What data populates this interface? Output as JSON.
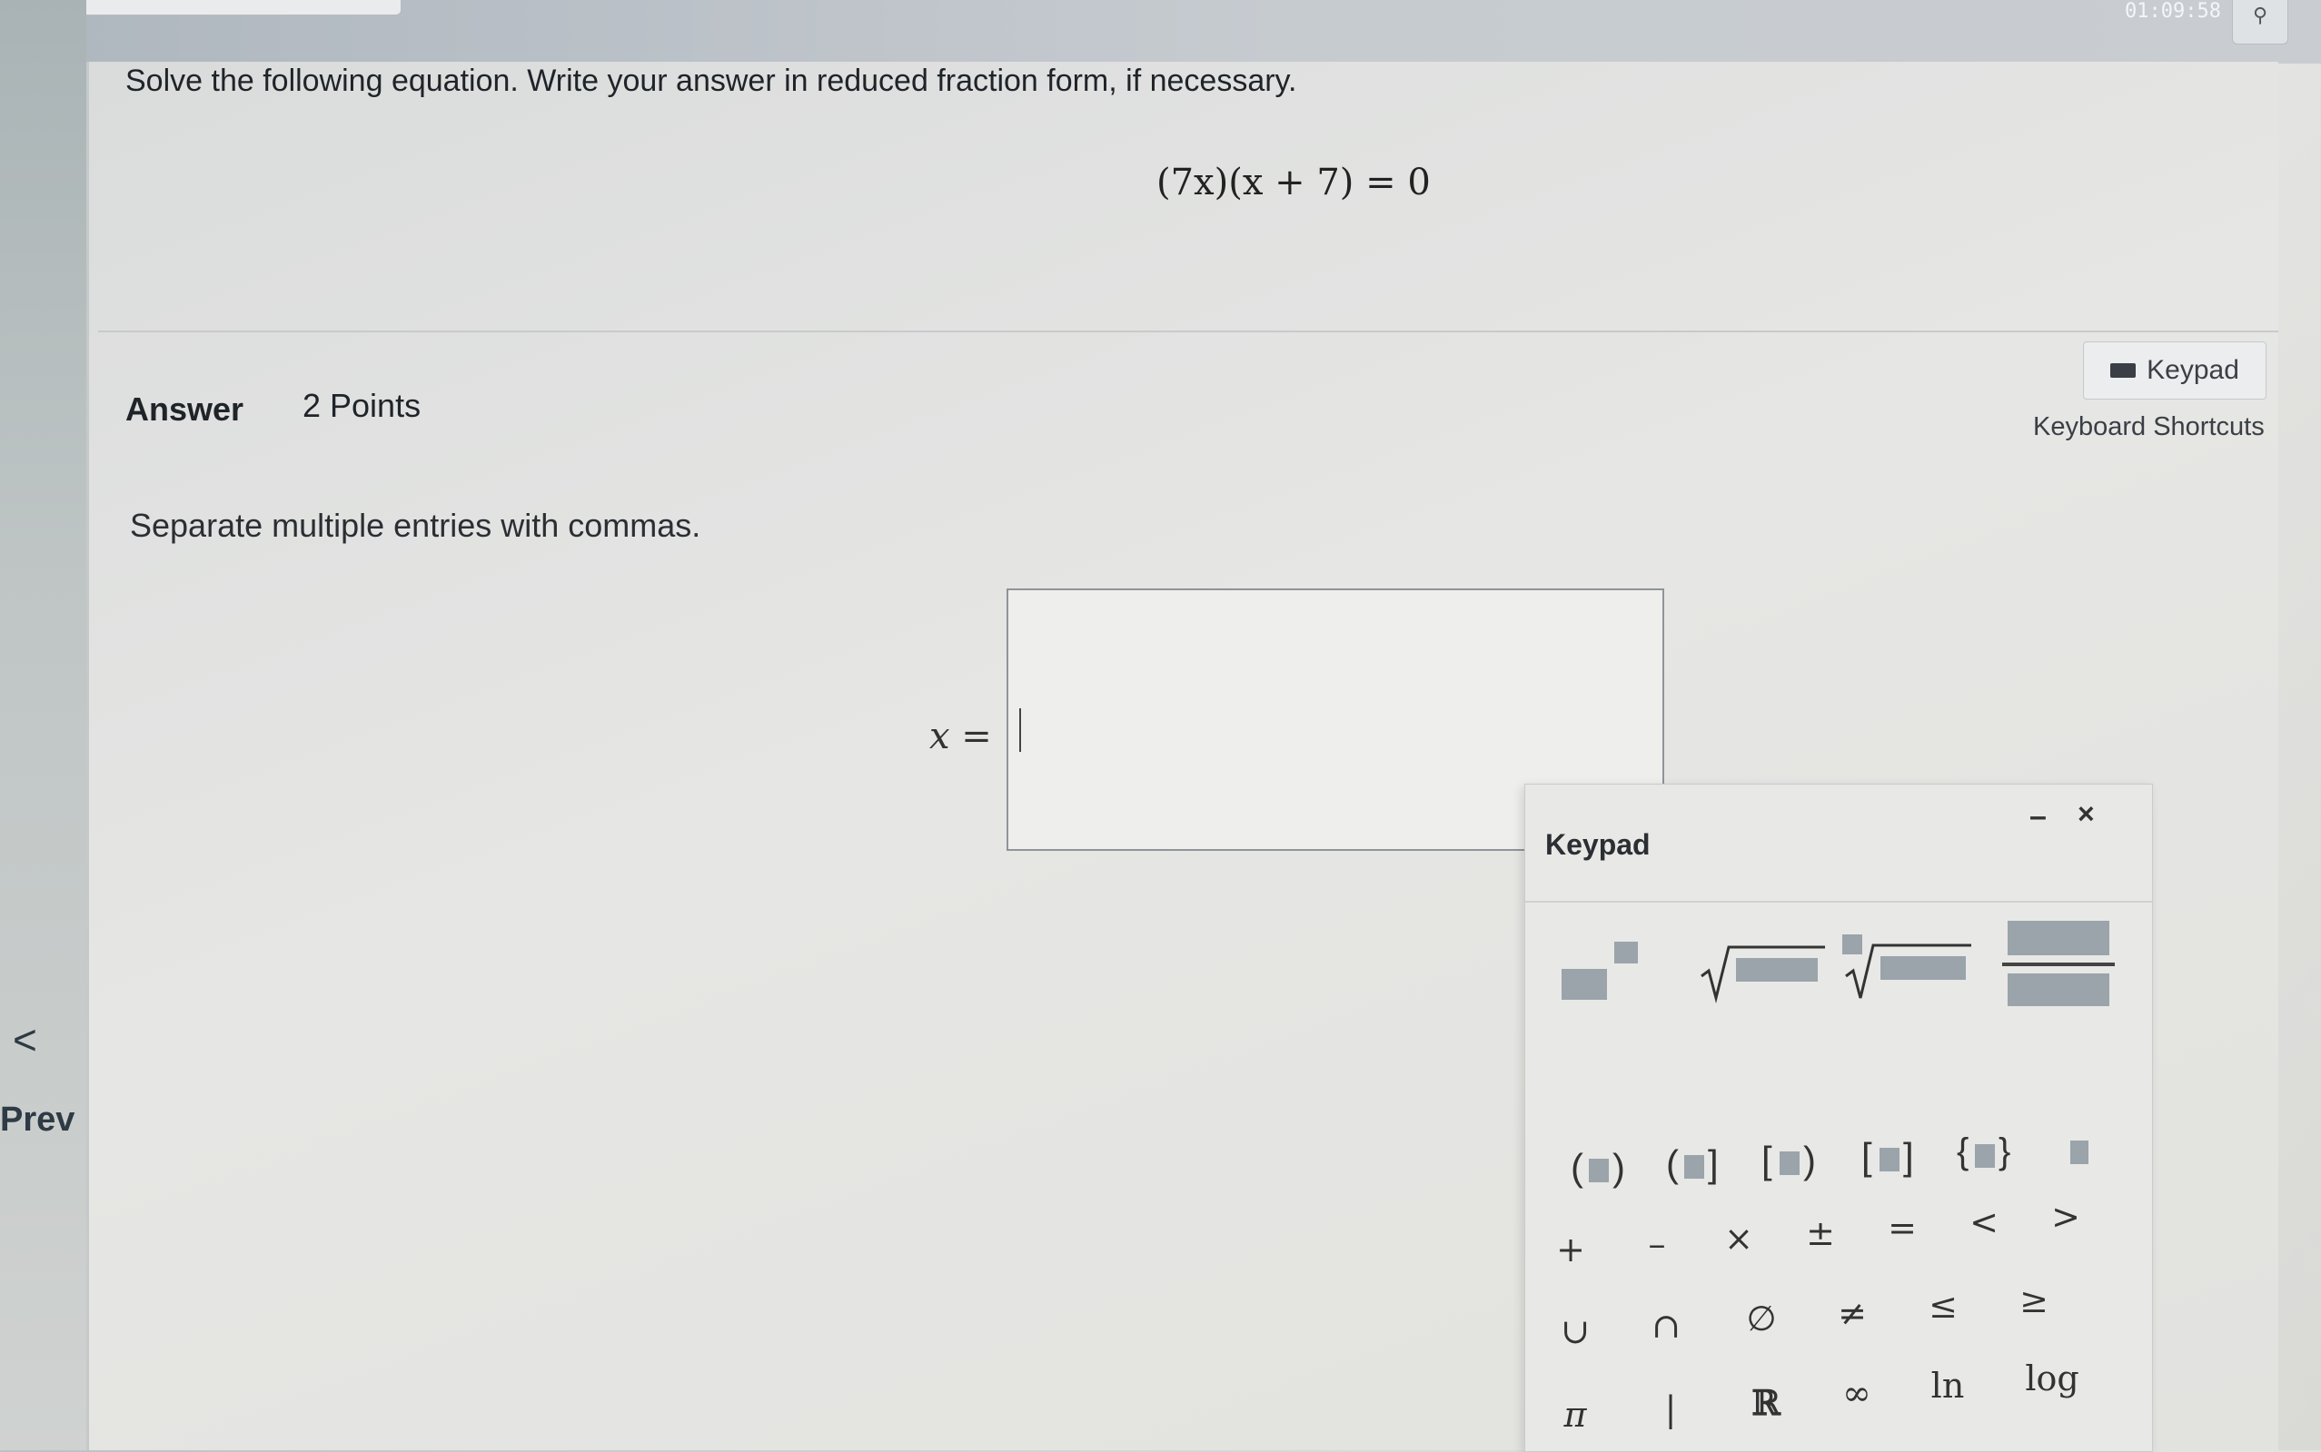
{
  "header": {
    "timer": "01:09:58",
    "timer_icon": "pin-icon"
  },
  "nav": {
    "prev_chevron": "<",
    "prev_label": "Prev"
  },
  "question": {
    "instruction": "Solve the following equation. Write your answer in reduced fraction form, if necessary.",
    "equation": "(7x)(x + 7) = 0"
  },
  "answer": {
    "label": "Answer",
    "points": "2 Points",
    "keypad_button_label": "Keypad",
    "shortcuts_label": "Keyboard Shortcuts",
    "separate_hint": "Separate multiple entries with commas.",
    "variable_prefix": "x =",
    "input_value": ""
  },
  "keypad": {
    "title": "Keypad",
    "minimize": "–",
    "close": "×",
    "row3": [
      "+",
      "–",
      "×",
      "±",
      "=",
      "<",
      ">"
    ],
    "row4": [
      "∪",
      "∩",
      "∅",
      "≠",
      "≤",
      "≥"
    ],
    "row5": [
      "π",
      "|",
      "ℝ",
      "∞",
      "ln",
      "log"
    ]
  }
}
